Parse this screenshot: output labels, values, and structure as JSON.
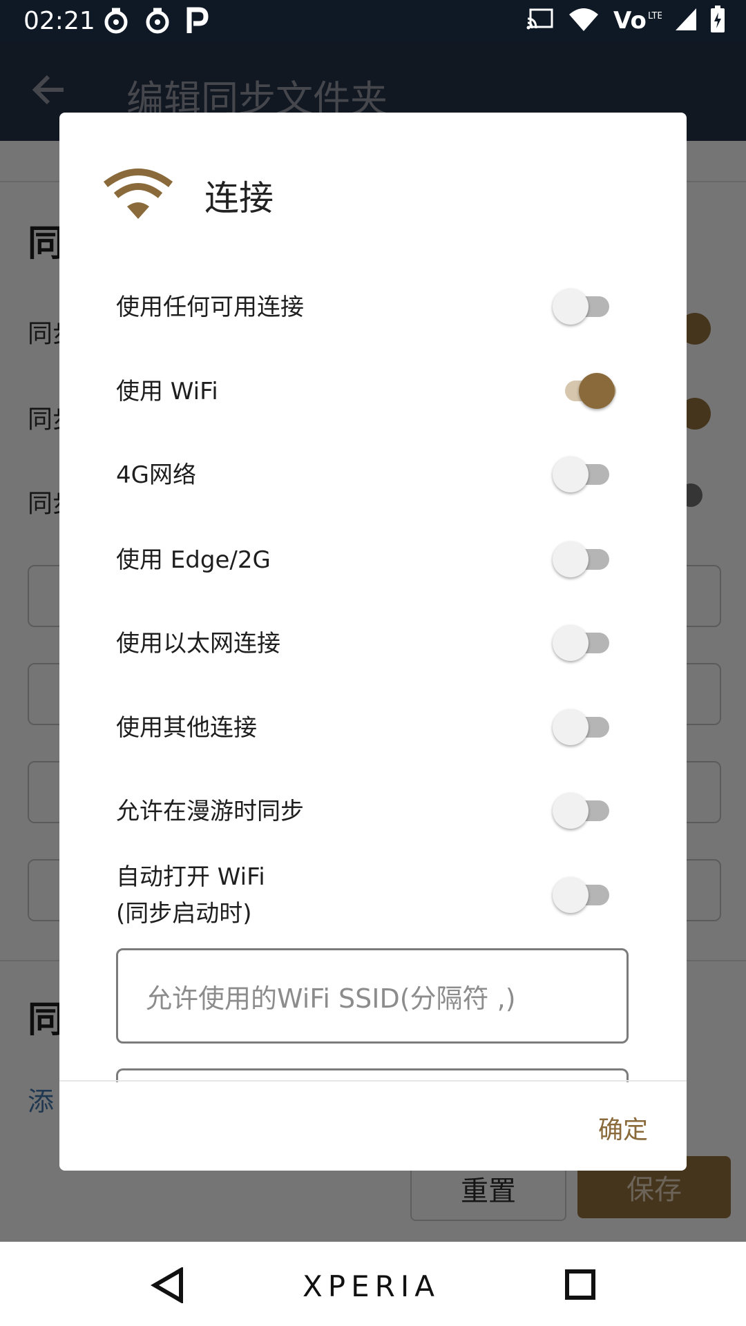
{
  "status_bar": {
    "time": "02:21",
    "left_icons": [
      "netease-icon",
      "netease-icon",
      "parking-icon"
    ],
    "right_icons": [
      "cast-icon",
      "wifi-icon",
      "volte-icon",
      "signal-icon",
      "battery-charging-icon"
    ]
  },
  "app_bar": {
    "title": "编辑同步文件夹"
  },
  "background": {
    "heading_1": "同",
    "rows": [
      "同步",
      "同步",
      "同步"
    ],
    "heading_2": "同",
    "link": "添",
    "reset_label": "重置",
    "save_label": "保存"
  },
  "dialog": {
    "title": "连接",
    "options": [
      {
        "label": "使用任何可用连接",
        "on": false
      },
      {
        "label": "使用 WiFi",
        "on": true
      },
      {
        "label": "4G网络",
        "on": false
      },
      {
        "label": "使用 Edge/2G",
        "on": false
      },
      {
        "label": "使用以太网连接",
        "on": false
      },
      {
        "label": "使用其他连接",
        "on": false
      },
      {
        "label": "允许在漫游时同步",
        "on": false
      },
      {
        "label": "自动打开 WiFi",
        "label_line2": "(同步启动时)",
        "on": false
      }
    ],
    "ssid_placeholder": "允许使用的WiFi SSID(分隔符 ,)",
    "ok_label": "确定"
  },
  "nav_bar": {
    "brand": "XPERIA"
  },
  "colors": {
    "accent": "#8a6a3a",
    "status_bar": "#0f1926",
    "app_bar": "#223045"
  }
}
